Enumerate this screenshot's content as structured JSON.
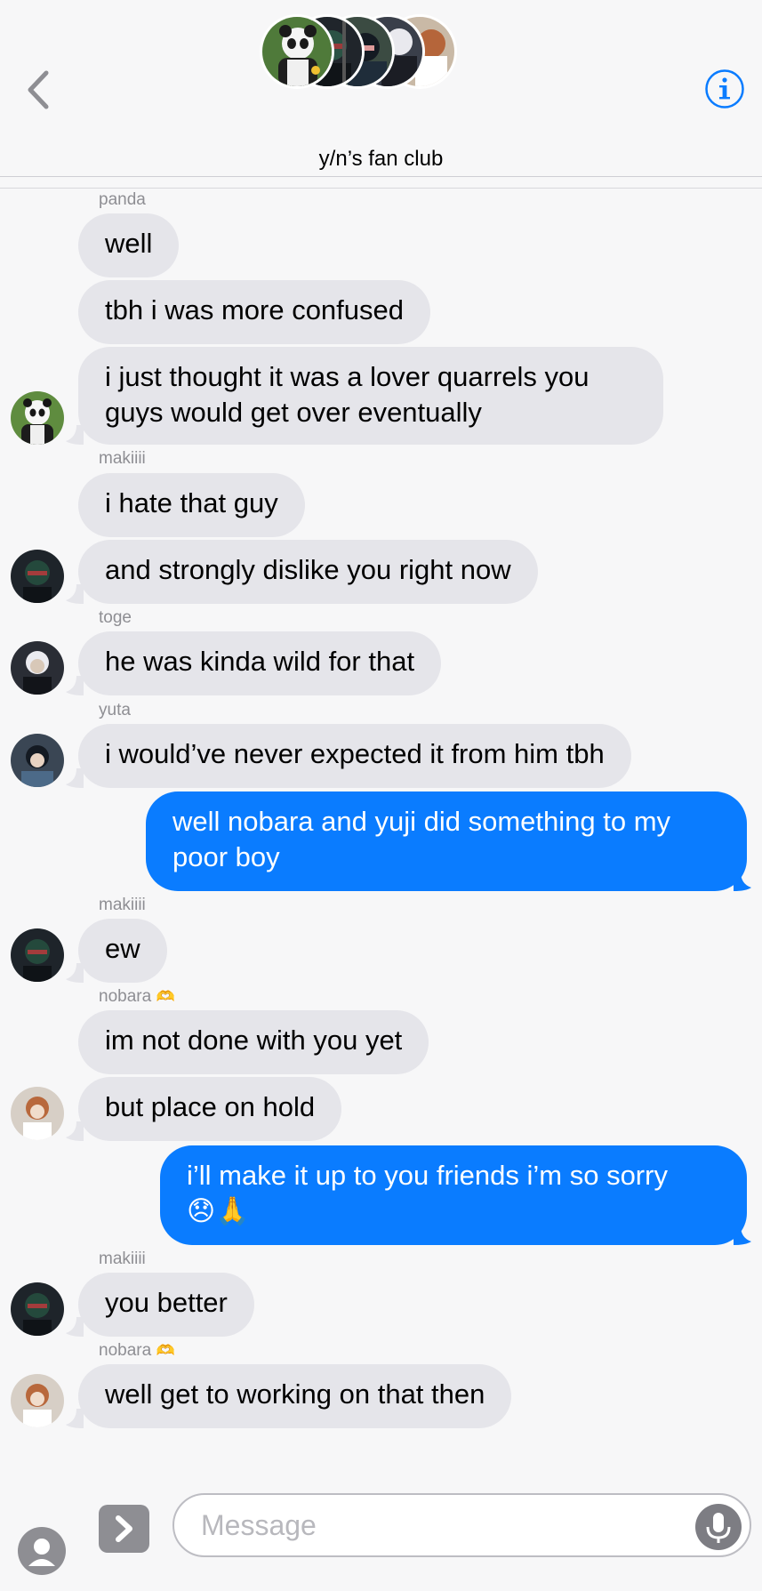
{
  "header": {
    "title": "y/n’s fan club",
    "participants": [
      {
        "name": "panda",
        "icon": "panda-avatar"
      },
      {
        "name": "makiiii",
        "icon": "maki-avatar"
      },
      {
        "name": "yuta",
        "icon": "yuta-avatar"
      },
      {
        "name": "toge",
        "icon": "toge-avatar"
      },
      {
        "name": "nobara",
        "icon": "nobara-avatar"
      }
    ],
    "back_icon": "chevron-left-icon",
    "info_icon": "info-icon"
  },
  "messages": [
    {
      "sender": "panda",
      "text": "well"
    },
    {
      "text": "tbh i was more confused"
    },
    {
      "text": "i just thought it was a lover quarrels you\nguys would get over eventually"
    },
    {
      "sender": "makiiii",
      "text": "i hate that guy"
    },
    {
      "text": "and strongly dislike you right now"
    },
    {
      "sender": "toge",
      "text": "he was kinda wild for that"
    },
    {
      "sender": "yuta",
      "text": "i would’ve never expected it from him tbh"
    },
    {
      "text": "well nobara and yuji did something to my\npoor boy"
    },
    {
      "sender": "makiiii",
      "text": "ew"
    },
    {
      "sender": "nobara",
      "sender_emoji": "🫶",
      "text": "im not done with you yet"
    },
    {
      "text": "but place on hold"
    },
    {
      "text": "i’ll make it up to you friends i’m so sorry\n😞🙏"
    },
    {
      "sender": "makiiii",
      "text": "you better"
    },
    {
      "sender": "nobara",
      "sender_emoji": "🫶",
      "text": "well get to working on that then"
    }
  ],
  "compose": {
    "placeholder": "Message",
    "contact_icon": "person-icon",
    "expand_icon": "chevron-right-icon",
    "mic_icon": "microphone-icon"
  },
  "colors": {
    "sent_bubble": "#0a7cff",
    "received_bubble": "#e5e5ea",
    "accent": "#0a7cff",
    "background": "#f7f7f8"
  }
}
